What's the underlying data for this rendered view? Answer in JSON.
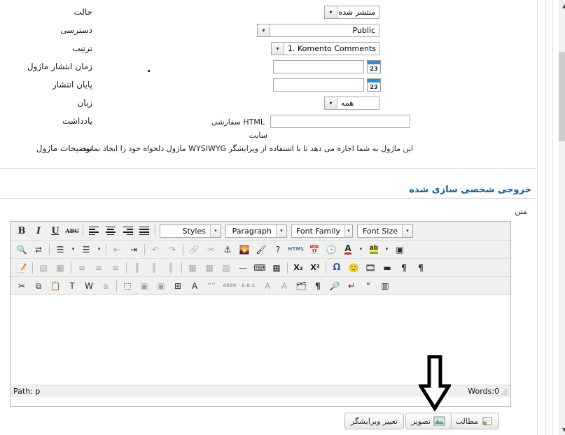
{
  "form": {
    "rows": [
      {
        "label": "حالت",
        "control": "select",
        "value": "منتشر شده"
      },
      {
        "label": "دسترسی",
        "control": "select",
        "value": "Public"
      },
      {
        "label": "ترتیب",
        "control": "select",
        "value": "1. Komento Comments"
      },
      {
        "label": "زمان انتشار ماژول",
        "control": "calendar",
        "value": ""
      },
      {
        "label": "پایان انتشار",
        "control": "calendar",
        "value": ""
      },
      {
        "label": "زبان",
        "control": "select",
        "value": "همه"
      },
      {
        "label": "یادداشت",
        "control": "text",
        "value": ""
      },
      {
        "label": "توضیحات ماژول",
        "control": "static",
        "value": ""
      }
    ],
    "custom_html_label": "HTML سفارشی",
    "site_label": "سایت",
    "module_description": "این ماژول به شما اجازه می دهد تا با استفاده از ویرایشگر WYSIWYG ماژول دلخواه خود را ایجاد نمایید.",
    "calendar_day": "23",
    "dropdown_arrow": "▾"
  },
  "section": {
    "heading": "خروجی شخصی سازی شده",
    "field_label": "متن"
  },
  "editor": {
    "toolbar_row1": [
      {
        "name": "bold-icon",
        "glyph": "B",
        "style": "bold-serif"
      },
      {
        "name": "italic-icon",
        "glyph": "I",
        "style": "italic-serif"
      },
      {
        "name": "underline-icon",
        "glyph": "U",
        "style": "underline-serif"
      },
      {
        "name": "strikethrough-icon",
        "glyph": "ABC",
        "style": "strike-small"
      },
      {
        "name": "separator",
        "glyph": "",
        "style": "sep"
      },
      {
        "name": "align-left-icon",
        "glyph": "",
        "style": "lines-left"
      },
      {
        "name": "align-center-icon",
        "glyph": "",
        "style": "lines-center"
      },
      {
        "name": "align-right-icon",
        "glyph": "",
        "style": "lines-right"
      },
      {
        "name": "align-justify-icon",
        "glyph": "",
        "style": "lines-justify"
      },
      {
        "name": "separator",
        "glyph": "",
        "style": "sep"
      }
    ],
    "combos": [
      {
        "name": "styles-dropdown",
        "label": "Styles"
      },
      {
        "name": "paragraph-dropdown",
        "label": "Paragraph"
      },
      {
        "name": "font-family-dropdown",
        "label": "Font Family"
      },
      {
        "name": "font-size-dropdown",
        "label": "Font Size"
      }
    ],
    "toolbar_row2": [
      {
        "name": "search-icon",
        "glyph": "🔍",
        "dim": false
      },
      {
        "name": "search-replace-icon",
        "glyph": "⮂",
        "dim": false
      },
      {
        "name": "separator",
        "glyph": "",
        "dim": false
      },
      {
        "name": "bullet-list-icon",
        "glyph": "☰",
        "dim": false
      },
      {
        "name": "bullet-list-arrow-icon",
        "glyph": "▾",
        "dim": false
      },
      {
        "name": "numbered-list-icon",
        "glyph": "☰",
        "dim": false
      },
      {
        "name": "numbered-list-arrow-icon",
        "glyph": "▾",
        "dim": false
      },
      {
        "name": "separator",
        "glyph": "",
        "dim": false
      },
      {
        "name": "outdent-icon",
        "glyph": "⇤",
        "dim": true
      },
      {
        "name": "indent-icon",
        "glyph": "⇥",
        "dim": false
      },
      {
        "name": "separator",
        "glyph": "",
        "dim": false
      },
      {
        "name": "undo-icon",
        "glyph": "↶",
        "dim": true
      },
      {
        "name": "redo-icon",
        "glyph": "↷",
        "dim": true
      },
      {
        "name": "separator",
        "glyph": "",
        "dim": false
      },
      {
        "name": "insert-link-icon",
        "glyph": "🔗",
        "dim": true
      },
      {
        "name": "unlink-icon",
        "glyph": "✂",
        "dim": true
      },
      {
        "name": "anchor-icon",
        "glyph": "⚓",
        "dim": false
      },
      {
        "name": "insert-image-icon",
        "glyph": "🌄",
        "dim": false
      },
      {
        "name": "cleanup-icon",
        "glyph": "🖌",
        "dim": false
      },
      {
        "name": "help-icon",
        "glyph": "?",
        "dim": false
      },
      {
        "name": "html-source-icon",
        "glyph": "HTML",
        "dim": false
      },
      {
        "name": "insert-date-icon",
        "glyph": "📅",
        "dim": false
      },
      {
        "name": "insert-time-icon",
        "glyph": "🕒",
        "dim": false
      },
      {
        "name": "forecolor-icon",
        "glyph": "A",
        "dim": false
      },
      {
        "name": "forecolor-arrow-icon",
        "glyph": "▾",
        "dim": false
      },
      {
        "name": "backcolor-icon",
        "glyph": "ab",
        "dim": false
      },
      {
        "name": "backcolor-arrow-icon",
        "glyph": "▾",
        "dim": false
      },
      {
        "name": "fullscreen-icon",
        "glyph": "▣",
        "dim": false
      }
    ],
    "toolbar_row3": [
      {
        "name": "edit-css-icon",
        "glyph": "📝",
        "dim": false
      },
      {
        "name": "separator",
        "glyph": "",
        "dim": false
      },
      {
        "name": "merge-cells-icon",
        "glyph": "▤",
        "dim": true
      },
      {
        "name": "split-cells-icon",
        "glyph": "▦",
        "dim": true
      },
      {
        "name": "separator",
        "glyph": "",
        "dim": false
      },
      {
        "name": "insert-row-before-icon",
        "glyph": "≡",
        "dim": true
      },
      {
        "name": "insert-row-after-icon",
        "glyph": "≡",
        "dim": true
      },
      {
        "name": "delete-row-icon",
        "glyph": "≡",
        "dim": true
      },
      {
        "name": "separator",
        "glyph": "",
        "dim": false
      },
      {
        "name": "insert-col-before-icon",
        "glyph": "║",
        "dim": true
      },
      {
        "name": "insert-col-after-icon",
        "glyph": "║",
        "dim": true
      },
      {
        "name": "delete-col-icon",
        "glyph": "║",
        "dim": true
      },
      {
        "name": "separator",
        "glyph": "",
        "dim": false
      },
      {
        "name": "table-icon",
        "glyph": "▦",
        "dim": true
      },
      {
        "name": "table-props-icon",
        "glyph": "▦",
        "dim": true
      },
      {
        "name": "cell-props-icon",
        "glyph": "▧",
        "dim": true
      },
      {
        "name": "horizontal-rule-icon",
        "glyph": "—",
        "dim": false
      },
      {
        "name": "remove-format-icon",
        "glyph": "⌨",
        "dim": false
      },
      {
        "name": "visual-aid-icon",
        "glyph": "▦",
        "dim": false
      },
      {
        "name": "separator",
        "glyph": "",
        "dim": false
      },
      {
        "name": "subscript-icon",
        "glyph": "X₂",
        "dim": false
      },
      {
        "name": "superscript-icon",
        "glyph": "X²",
        "dim": false
      },
      {
        "name": "separator",
        "glyph": "",
        "dim": false
      },
      {
        "name": "special-char-icon",
        "glyph": "Ω",
        "dim": false
      },
      {
        "name": "emoticon-icon",
        "glyph": "🙂",
        "dim": false
      },
      {
        "name": "insert-media-icon",
        "glyph": "🎞",
        "dim": false
      },
      {
        "name": "page-break-icon",
        "glyph": "▬",
        "dim": false
      },
      {
        "name": "ltr-direction-icon",
        "glyph": "¶",
        "dim": false
      },
      {
        "name": "rtl-direction-icon",
        "glyph": "¶",
        "dim": false
      }
    ],
    "toolbar_row4": [
      {
        "name": "cut-icon",
        "glyph": "✂",
        "dim": false
      },
      {
        "name": "copy-icon",
        "glyph": "⧉",
        "dim": false
      },
      {
        "name": "paste-icon",
        "glyph": "📋",
        "dim": false
      },
      {
        "name": "paste-text-icon",
        "glyph": "T",
        "dim": false
      },
      {
        "name": "paste-word-icon",
        "glyph": "W",
        "dim": false
      },
      {
        "name": "select-all-icon",
        "glyph": "a",
        "dim": true
      },
      {
        "name": "separator",
        "glyph": "",
        "dim": false
      },
      {
        "name": "insert-layer-icon",
        "glyph": "⬚",
        "dim": false
      },
      {
        "name": "move-forward-icon",
        "glyph": "▣",
        "dim": true
      },
      {
        "name": "move-backward-icon",
        "glyph": "▣",
        "dim": true
      },
      {
        "name": "absolute-position-icon",
        "glyph": "⊞",
        "dim": false
      },
      {
        "name": "style-props-icon",
        "glyph": "A",
        "dim": false
      },
      {
        "name": "citation-icon",
        "glyph": "“”",
        "dim": true
      },
      {
        "name": "abbreviation-icon",
        "glyph": "ABBR",
        "dim": true
      },
      {
        "name": "acronym-icon",
        "glyph": "A.B.C.",
        "dim": true
      },
      {
        "name": "insert-del-icon",
        "glyph": "A",
        "dim": true
      },
      {
        "name": "insert-ins-icon",
        "glyph": "A",
        "dim": true
      },
      {
        "name": "attributes-icon",
        "glyph": "🗂",
        "dim": false
      },
      {
        "name": "show-blocks-icon",
        "glyph": "¶",
        "dim": false
      },
      {
        "name": "preview-icon",
        "glyph": "🔎",
        "dim": false
      },
      {
        "name": "nonbreaking-icon",
        "glyph": "↵",
        "dim": false
      },
      {
        "name": "blockquote-icon",
        "glyph": "“",
        "dim": false
      },
      {
        "name": "template-icon",
        "glyph": "▥",
        "dim": false
      }
    ],
    "status_path": "Path: p",
    "status_words": "Words:0",
    "content": ""
  },
  "buttons": [
    {
      "name": "articles-button",
      "label": "مطالب",
      "icon": "article-icon"
    },
    {
      "name": "image-button",
      "label": "تصویر",
      "icon": "image-icon"
    },
    {
      "name": "toggle-editor-button",
      "label": "تغییر ویرایشگر",
      "icon": ""
    }
  ],
  "annotation": {
    "name": "down-arrow-annotation",
    "color": "#000000"
  },
  "colors": {
    "heading": "#0b5c96",
    "panel_bg": "#ffffff",
    "toolbar_bg": "#f0f0ef",
    "border": "#b5b5b5"
  }
}
